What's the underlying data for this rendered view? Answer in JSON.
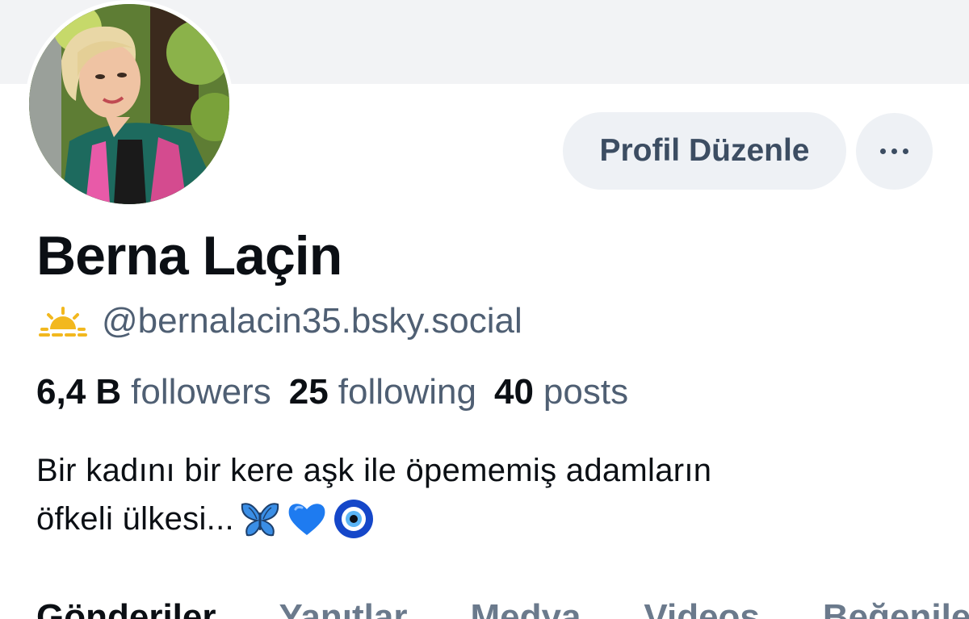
{
  "profile": {
    "display_name": "Berna Laçin",
    "handle": "@bernalacin35.bsky.social",
    "handle_icon": "sun-icon",
    "avatar": "profile-photo"
  },
  "actions": {
    "edit_label": "Profil Düzenle",
    "more_icon": "more-options-icon"
  },
  "stats": {
    "followers_count": "6,4 B",
    "followers_label": "followers",
    "following_count": "25",
    "following_label": "following",
    "posts_count": "40",
    "posts_label": "posts"
  },
  "bio": {
    "line1": "Bir kadını bir kere aşk ile öpememiş adamların",
    "line2": "öfkeli ülkesi...",
    "emojis": [
      "butterfly",
      "blue-heart",
      "nazar-amulet"
    ]
  },
  "tabs": [
    {
      "label": "Gönderiler",
      "active": true
    },
    {
      "label": "Yanıtlar",
      "active": false
    },
    {
      "label": "Medya",
      "active": false
    },
    {
      "label": "Videos",
      "active": false
    },
    {
      "label": "Beğeniler",
      "active": false
    }
  ],
  "colors": {
    "banner": "#f2f3f5",
    "button_bg": "#eef1f5",
    "button_text": "#3c4d62",
    "primary_text": "#0b0f14",
    "secondary_text": "#4f5f73",
    "sun_accent": "#f2b81f",
    "heart": "#1e7bf0"
  }
}
